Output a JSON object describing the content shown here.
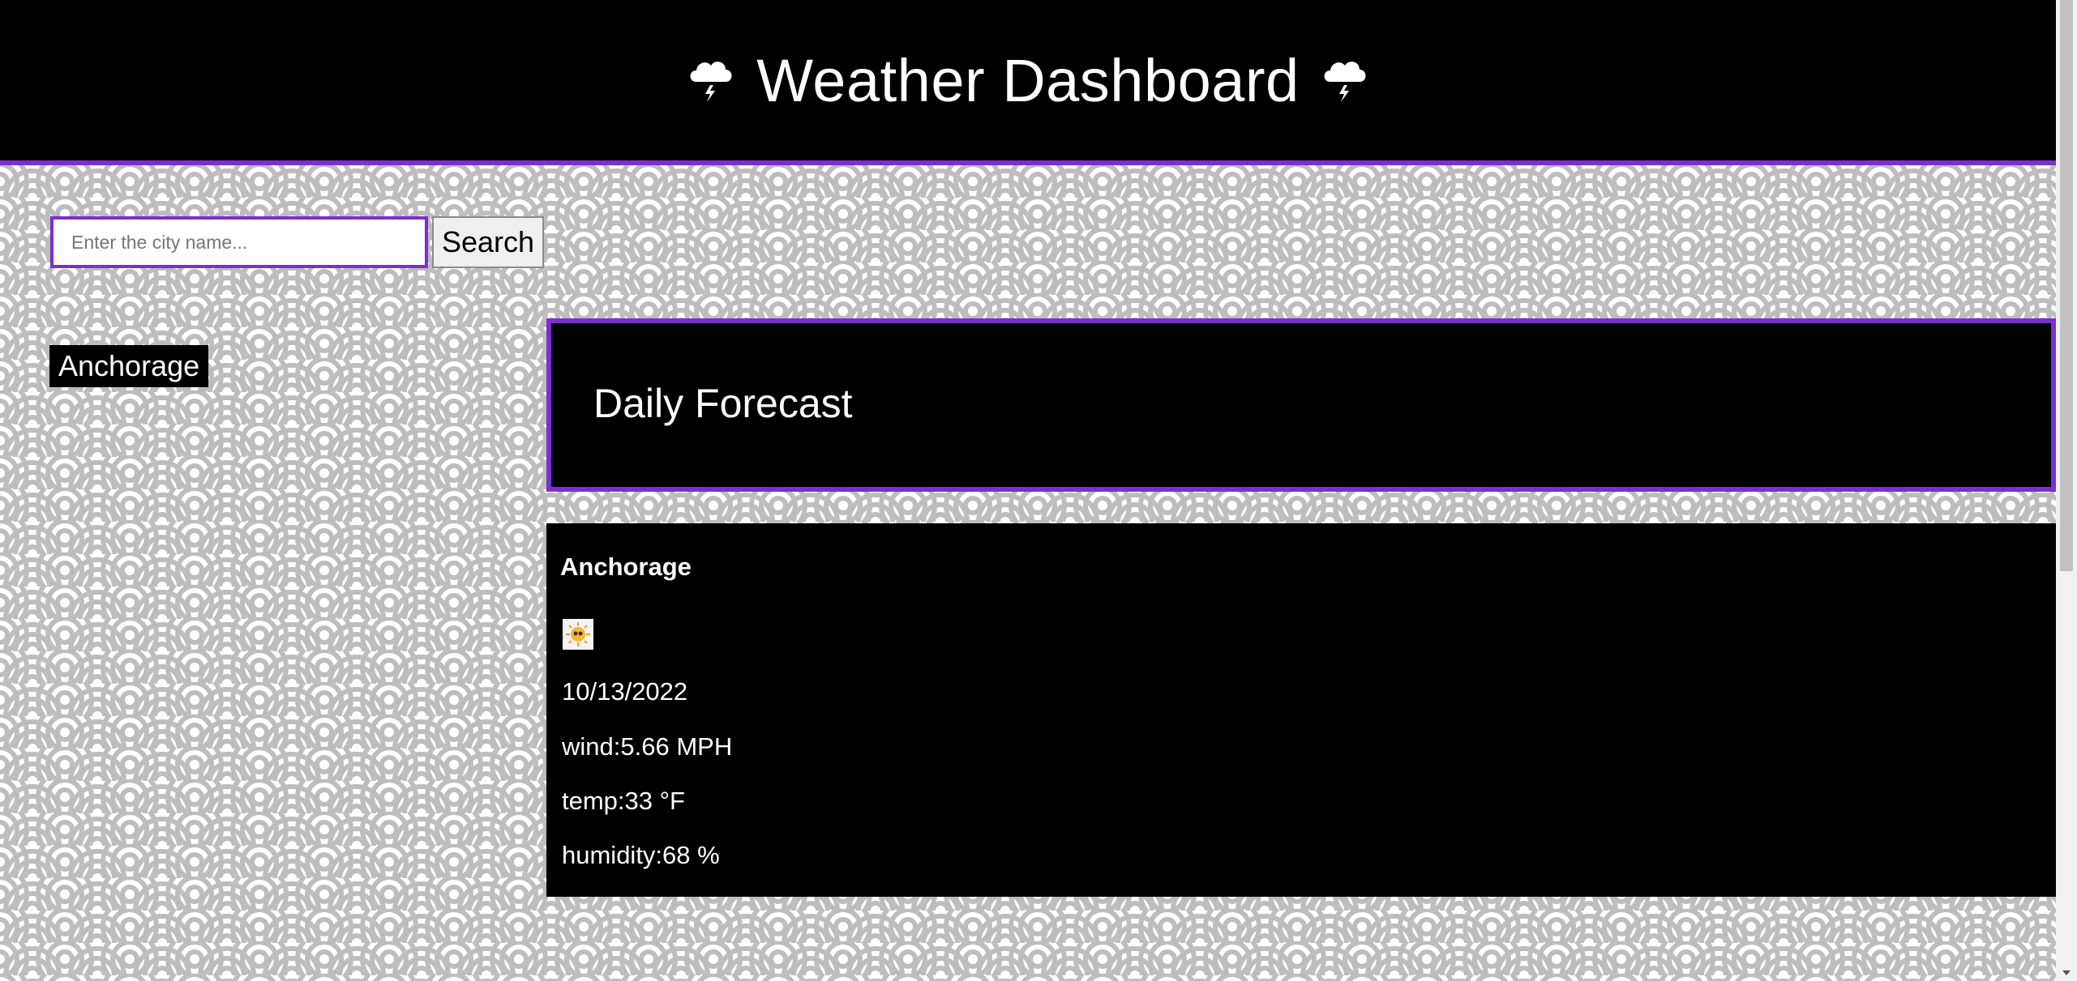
{
  "header": {
    "title": "Weather Dashboard",
    "left_icon": "thunder-cloud-icon",
    "right_icon": "thunder-cloud-icon"
  },
  "colors": {
    "accent": "#7b2fd0",
    "header_bg": "#000000",
    "pattern_fg": "#bdbdbd",
    "pattern_bg": "#ffffff"
  },
  "search": {
    "placeholder": "Enter the city name...",
    "value": "",
    "button_label": "Search"
  },
  "history": [
    {
      "label": "Anchorage"
    }
  ],
  "daily": {
    "title": "Daily Forecast"
  },
  "current": {
    "city": "Anchorage",
    "icon": "sun-weather-icon",
    "date": "10/13/2022",
    "wind": "wind:5.66 MPH",
    "temp": "temp:33 °F",
    "humidity": "humidity:68 %"
  }
}
